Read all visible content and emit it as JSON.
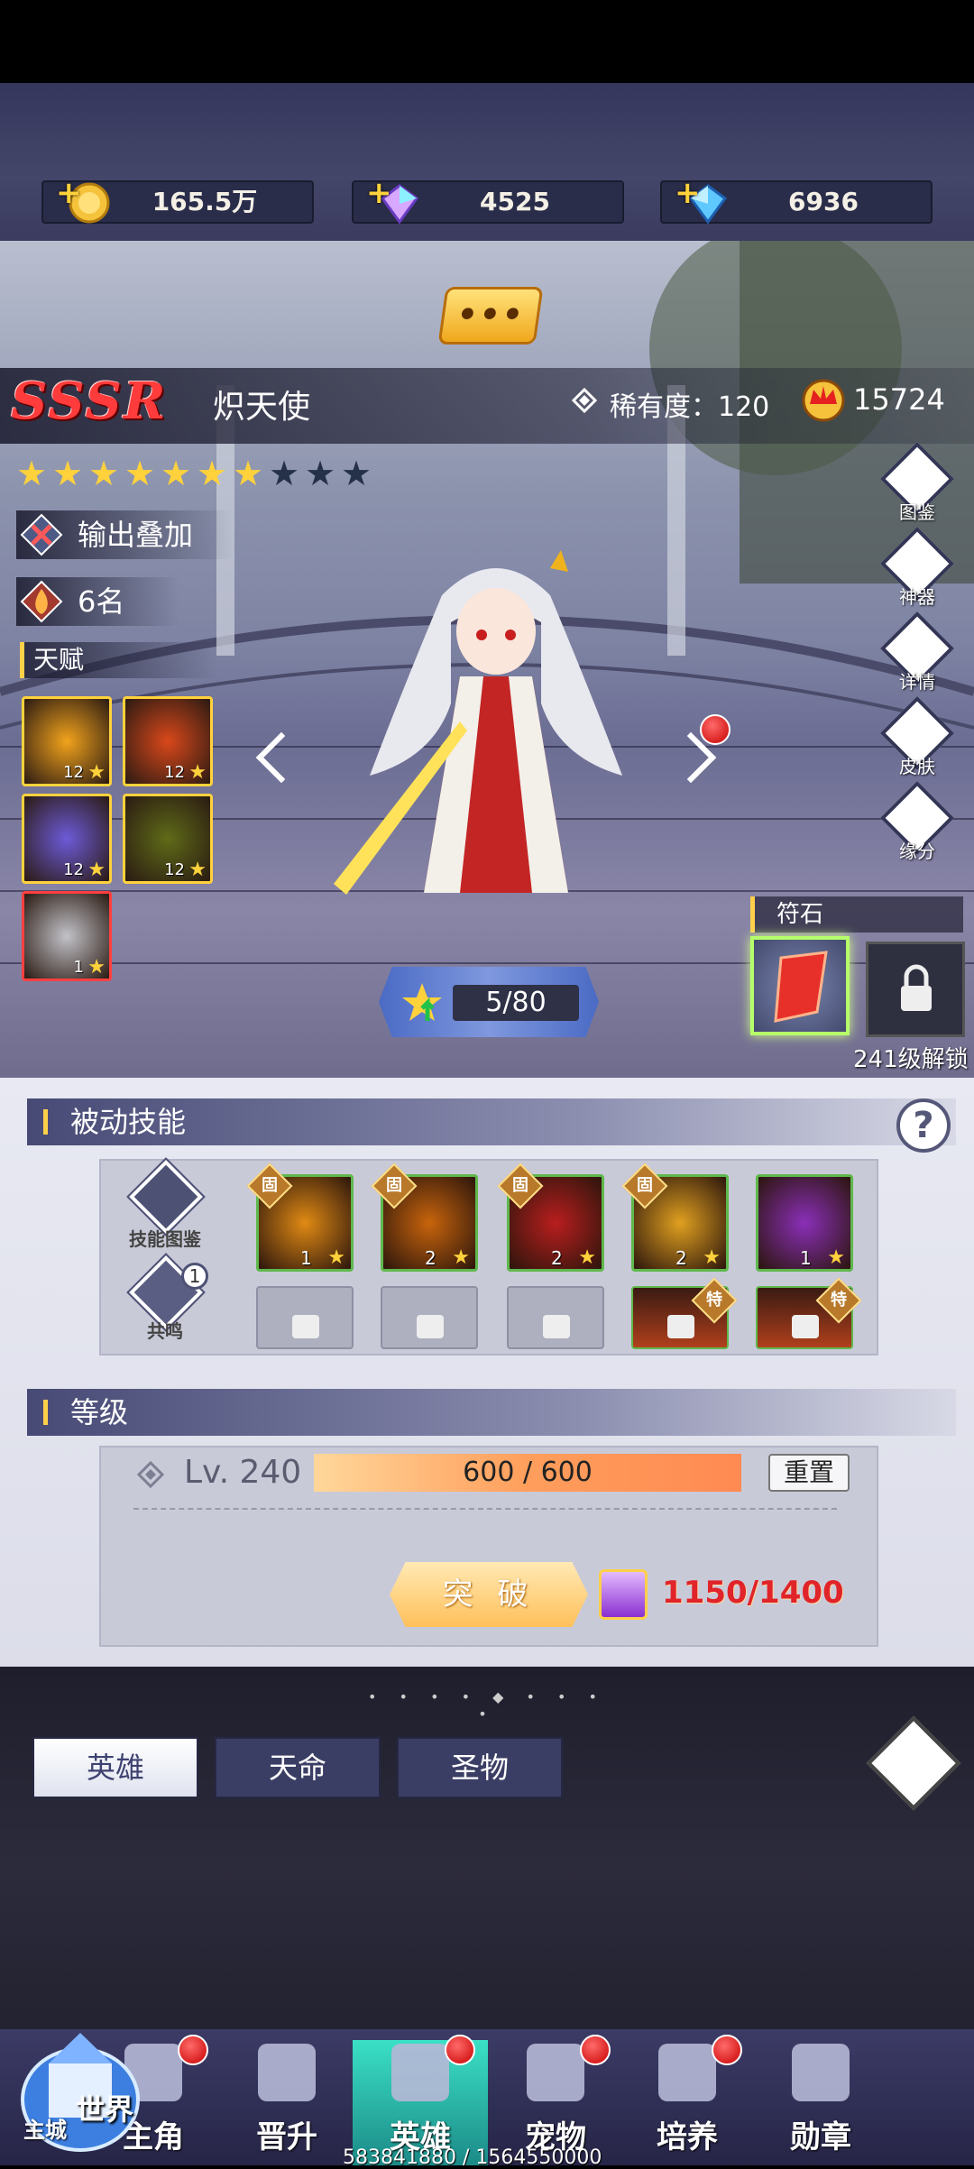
{
  "currencies": [
    {
      "name": "gold-coin",
      "value": "165.5万"
    },
    {
      "name": "rainbow-diamond",
      "value": "4525"
    },
    {
      "name": "blue-diamond",
      "value": "6936"
    }
  ],
  "hero": {
    "grade": "SSSR",
    "name": "炽天使",
    "rarity": "稀有度：120",
    "power": "15724",
    "stars_total": 10,
    "stars_filled": 7,
    "tag_role": "输出叠加",
    "tag_rank": "6名",
    "talent_title": "天赋",
    "star_progress": "5/80"
  },
  "talents": [
    {
      "level": "12",
      "color": "#f2a31c"
    },
    {
      "level": "12",
      "color": "#d9481b"
    },
    {
      "level": "12",
      "color": "#6d5bd8"
    },
    {
      "level": "12",
      "color": "#5f6b18"
    },
    {
      "level": "1",
      "color": "#c2c2c8"
    }
  ],
  "side_menu": [
    {
      "label": "图鉴",
      "icon": "codex-icon"
    },
    {
      "label": "神器",
      "icon": "artifact-icon"
    },
    {
      "label": "详情",
      "icon": "details-icon"
    },
    {
      "label": "皮肤",
      "icon": "skin-icon"
    },
    {
      "label": "缘分",
      "icon": "bond-icon"
    }
  ],
  "runes": {
    "title": "符石",
    "unlock": "241级解锁"
  },
  "passive": {
    "title": "被动技能",
    "codex_label": "技能图鉴",
    "resonance_label": "共鸣",
    "resonance_badge": "1",
    "fixed_mark": "固",
    "special_mark": "特",
    "skills": [
      {
        "level": "1",
        "color": "#e08a14"
      },
      {
        "level": "2",
        "color": "#c8640c"
      },
      {
        "level": "2",
        "color": "#b81e1e"
      },
      {
        "level": "2",
        "color": "#e0a020"
      },
      {
        "level": "1",
        "color": "#8a2fb8"
      }
    ]
  },
  "level": {
    "title": "等级",
    "lv": "Lv. 240",
    "exp": "600 / 600",
    "exp_fraction": 1.0,
    "reset": "重置",
    "breakthrough": "突 破",
    "cost": "1150/1400"
  },
  "tabs": [
    "英雄",
    "天命",
    "圣物"
  ],
  "nav": [
    {
      "label": "主角",
      "dot": true
    },
    {
      "label": "晋升",
      "dot": false
    },
    {
      "label": "英雄",
      "dot": true,
      "active": true
    },
    {
      "label": "宠物",
      "dot": true
    },
    {
      "label": "培养",
      "dot": true
    },
    {
      "label": "勋章",
      "dot": false
    }
  ],
  "world": {
    "title": "世界",
    "subtitle": "主城"
  },
  "footer": "583841880 / 1564550000"
}
